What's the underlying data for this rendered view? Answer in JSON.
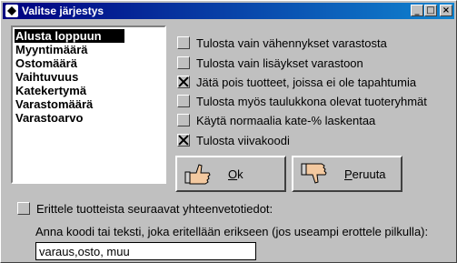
{
  "window": {
    "title": "Valitse järjestys",
    "controls": {
      "minimize": "_",
      "maximize": "□",
      "close": "×"
    }
  },
  "sort_list": {
    "items": [
      "Alusta loppuun",
      "Myyntimäärä",
      "Ostomäärä",
      "Vaihtuvuus",
      "Katekertymä",
      "Varastomäärä",
      "Varastoarvo"
    ],
    "selected_index": 0
  },
  "options": [
    {
      "label": "Tulosta vain vähennykset varastosta",
      "checked": false
    },
    {
      "label": "Tulosta vain lisäykset varastoon",
      "checked": false
    },
    {
      "label": "Jätä pois tuotteet, joissa ei ole tapahtumia",
      "checked": true
    },
    {
      "label": "Tulosta myös taulukkona olevat tuoteryhmät",
      "checked": false
    },
    {
      "label": "Käytä normaalia kate-% laskentaa",
      "checked": false
    },
    {
      "label": "Tulosta viivakoodi",
      "checked": true
    }
  ],
  "buttons": {
    "ok": {
      "mnemonic": "O",
      "rest": "k",
      "icon": "thumbs-up-hand-icon"
    },
    "cancel": {
      "mnemonic": "P",
      "rest": "eruuta",
      "icon": "thumbs-down-hand-icon"
    }
  },
  "erittele": {
    "label": "Erittele tuotteista seuraavat yhteenvetotiedot:",
    "checked": false
  },
  "code_field": {
    "label": "Anna koodi tai teksti, joka eritellään erikseen (jos useampi erottele pilkulla):",
    "value": "varaus,osto, muu"
  },
  "colors": {
    "titlebar_start": "#000080",
    "titlebar_end": "#1084d0",
    "face": "#c0c0c0"
  }
}
